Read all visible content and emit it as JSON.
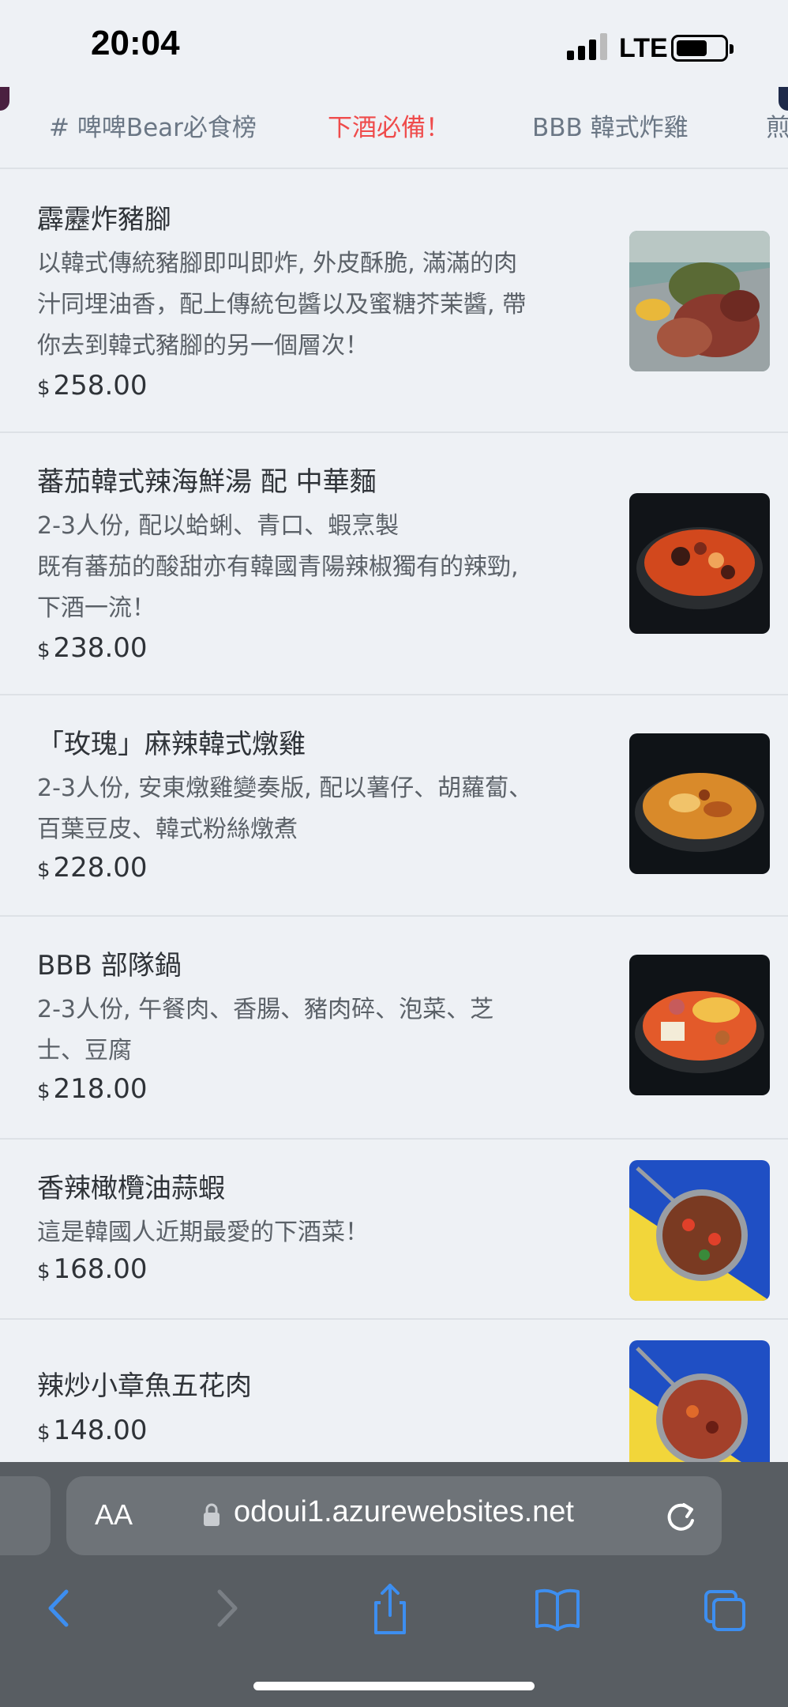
{
  "status_bar": {
    "time": "20:04",
    "network": "LTE"
  },
  "tabs": [
    {
      "label": "# 啤啤Bear必食榜",
      "active": false
    },
    {
      "label": "下酒必備！",
      "active": true
    },
    {
      "label": "BBB 韓式炸雞",
      "active": false
    },
    {
      "label": "煎",
      "active": false
    }
  ],
  "menu_items": [
    {
      "name": "霹靂炸豬腳",
      "description": "以韓式傳統豬腳即叫即炸, 外皮酥脆, 滿滿的肉\n汁同埋油香，配上傳統包醬以及蜜糖芥茉醬, 帶\n你去到韓式豬腳的另一個層次！",
      "currency": "$",
      "price": "258.00",
      "image": "fried-pork-knuckle-photo"
    },
    {
      "name": "蕃茄韓式辣海鮮湯 配 中華麵",
      "description": "2-3人份, 配以蛤蜊、青口、蝦烹製\n既有蕃茄的酸甜亦有韓國青陽辣椒獨有的辣勁,\n下酒一流！",
      "currency": "$",
      "price": "238.00",
      "image": "spicy-seafood-soup-photo"
    },
    {
      "name": "「玫瑰」麻辣韓式燉雞",
      "description": "2-3人份, 安東燉雞變奏版, 配以薯仔、胡蘿蔔、\n百葉豆皮、韓式粉絲燉煮",
      "currency": "$",
      "price": "228.00",
      "image": "braised-chicken-photo"
    },
    {
      "name": "BBB 部隊鍋",
      "description": "2-3人份, 午餐肉、香腸、豬肉碎、泡菜、芝\n士、豆腐",
      "currency": "$",
      "price": "218.00",
      "image": "army-stew-photo"
    },
    {
      "name": "香辣橄欖油蒜蝦",
      "description": "這是韓國人近期最愛的下酒菜！",
      "currency": "$",
      "price": "168.00",
      "image": "garlic-shrimp-photo"
    },
    {
      "name": "辣炒小章魚五花肉",
      "description": "",
      "currency": "$",
      "price": "148.00",
      "image": "octopus-pork-photo"
    }
  ],
  "browser": {
    "text_size_label": "AA",
    "url": "odoui1.azurewebsites.net"
  },
  "colors": {
    "accent": "#ef4b4b",
    "background": "#eef1f5",
    "toolbar": "#585d62",
    "ios_blue": "#3d8ef0"
  }
}
